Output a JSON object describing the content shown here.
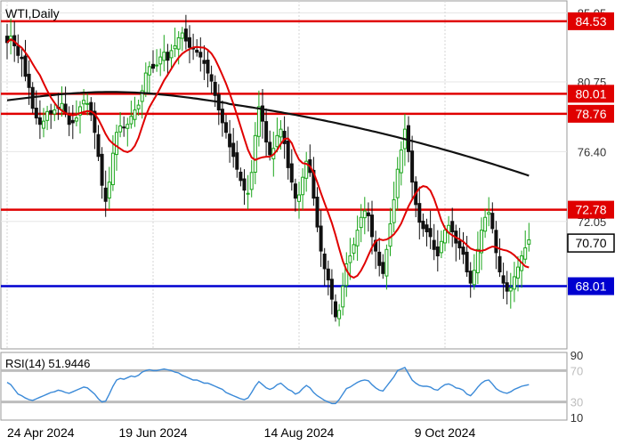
{
  "chart_data": {
    "type": "candlestick",
    "title": "WTI,Daily",
    "price_axis": {
      "ticks": [
        "85.05",
        "80.75",
        "76.40",
        "72.05"
      ],
      "ylim": [
        64.1,
        85.8
      ],
      "grid": true
    },
    "x_axis": {
      "ticks": [
        {
          "label": "24 Apr 2024",
          "index": 0
        },
        {
          "label": "19 Jun 2024",
          "index": 40
        },
        {
          "label": "14 Aug 2024",
          "index": 80
        },
        {
          "label": "9 Oct 2024",
          "index": 120
        }
      ]
    },
    "horizontal_levels": [
      {
        "value": 84.53,
        "label": "84.53",
        "color": "#e00000"
      },
      {
        "value": 80.01,
        "label": "80.01",
        "color": "#e00000"
      },
      {
        "value": 78.76,
        "label": "78.76",
        "color": "#e00000"
      },
      {
        "value": 72.78,
        "label": "72.78",
        "color": "#e00000"
      },
      {
        "value": 68.01,
        "label": "68.01",
        "color": "#0000d0"
      }
    ],
    "last_price": {
      "value": 70.7,
      "label": "70.70"
    },
    "close": [
      83.2,
      83.6,
      83.0,
      82.4,
      82.2,
      81.1,
      80.4,
      79.1,
      78.5,
      78.1,
      78.3,
      78.9,
      78.8,
      79.0,
      79.1,
      79.4,
      78.8,
      78.1,
      78.2,
      78.5,
      79.2,
      79.6,
      79.4,
      78.7,
      77.6,
      76.1,
      74.3,
      73.3,
      74.5,
      76.3,
      77.6,
      78.0,
      77.9,
      78.1,
      78.6,
      79.0,
      79.3,
      80.2,
      81.3,
      81.7,
      81.6,
      81.8,
      82.3,
      82.6,
      82.1,
      82.7,
      83.0,
      83.5,
      83.8,
      83.3,
      82.9,
      82.8,
      82.6,
      82.3,
      81.9,
      81.3,
      80.8,
      79.9,
      79.0,
      78.2,
      77.6,
      76.7,
      76.1,
      75.3,
      74.6,
      74.0,
      73.8,
      75.1,
      77.4,
      79.2,
      78.3,
      77.0,
      76.2,
      76.6,
      77.4,
      77.8,
      76.9,
      75.4,
      74.5,
      73.5,
      73.7,
      74.8,
      75.8,
      75.1,
      73.5,
      71.7,
      70.2,
      69.1,
      68.4,
      67.2,
      66.1,
      66.5,
      68.0,
      69.4,
      69.9,
      70.6,
      71.5,
      72.3,
      72.7,
      72.4,
      71.1,
      70.2,
      69.3,
      68.8,
      70.3,
      71.9,
      73.4,
      75.3,
      76.5,
      77.8,
      76.4,
      74.5,
      73.1,
      72.0,
      71.6,
      71.4,
      71.1,
      70.3,
      69.9,
      70.8,
      71.5,
      71.8,
      71.4,
      70.7,
      70.4,
      70.0,
      68.9,
      68.2,
      69.0,
      70.3,
      71.5,
      72.3,
      72.6,
      71.6,
      70.1,
      68.9,
      68.2,
      67.7,
      67.9,
      68.6,
      69.2,
      69.9,
      70.4,
      70.9
    ],
    "ma_fast_last": 70.55,
    "ma_slow_start": 79.6,
    "ma_slow_end": 74.9,
    "rsi": {
      "label": "RSI(14) 51.9446",
      "ticks": [
        "90",
        "70",
        "30",
        "10"
      ],
      "levels": [
        70,
        30
      ],
      "ylim": [
        8,
        92
      ],
      "values": [
        55,
        52,
        46,
        40,
        38,
        35,
        33,
        32,
        34,
        36,
        38,
        40,
        42,
        43,
        45,
        44,
        42,
        41,
        43,
        45,
        47,
        49,
        48,
        44,
        40,
        34,
        30,
        31,
        40,
        50,
        58,
        60,
        59,
        61,
        63,
        62,
        64,
        68,
        70,
        71,
        70,
        70,
        71,
        72,
        71,
        70,
        68,
        67,
        64,
        62,
        60,
        58,
        58,
        56,
        54,
        54,
        52,
        50,
        48,
        46,
        42,
        40,
        38,
        36,
        34,
        33,
        35,
        42,
        50,
        56,
        52,
        48,
        46,
        48,
        52,
        54,
        50,
        46,
        44,
        40,
        42,
        47,
        51,
        48,
        42,
        38,
        35,
        32,
        30,
        28,
        28,
        33,
        40,
        47,
        49,
        52,
        55,
        57,
        58,
        57,
        52,
        48,
        45,
        44,
        50,
        56,
        62,
        70,
        72,
        74,
        66,
        58,
        54,
        51,
        50,
        50,
        49,
        46,
        45,
        49,
        52,
        53,
        51,
        48,
        47,
        45,
        40,
        38,
        43,
        49,
        54,
        57,
        58,
        53,
        47,
        44,
        42,
        41,
        43,
        46,
        48,
        50,
        51,
        52
      ]
    }
  }
}
